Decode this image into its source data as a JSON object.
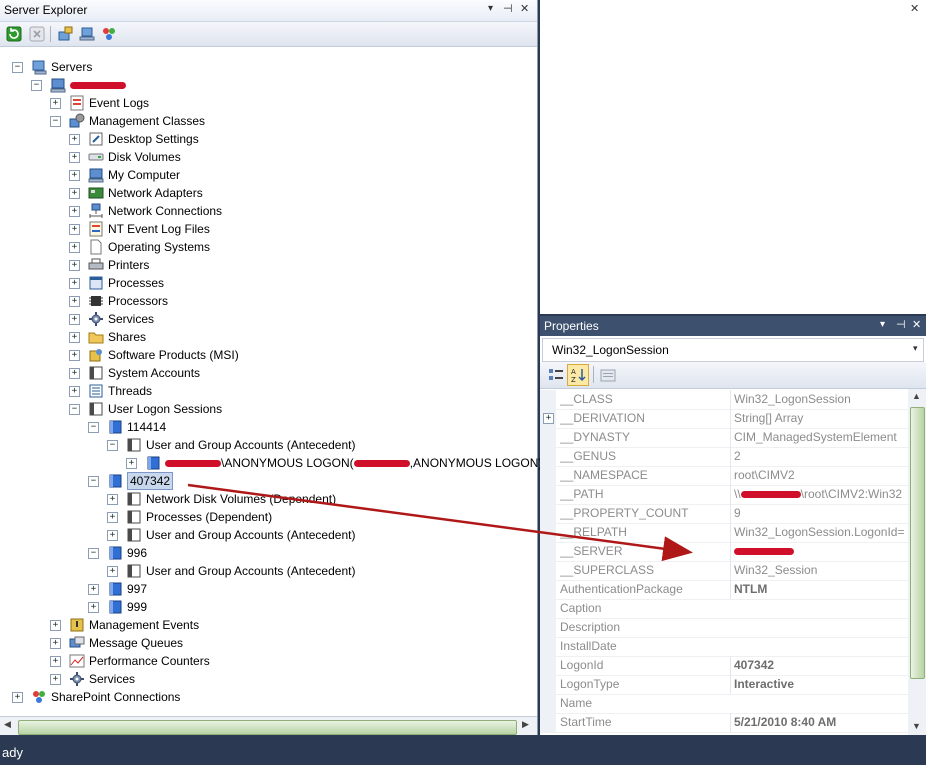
{
  "server_explorer": {
    "title": "Server Explorer",
    "title_buttons": [
      "▾",
      "⊣",
      "✕"
    ],
    "toolbar": [
      "refresh-icon",
      "stop-icon",
      "connect-db-icon",
      "connect-server-icon",
      "sharepoint-icon"
    ]
  },
  "tree": [
    {
      "label": "Servers",
      "icon": "servers-icon",
      "expanded": true
    },
    {
      "label": "",
      "icon": "computer-icon",
      "expanded": true,
      "redacted": true
    },
    {
      "label": "Event Logs",
      "icon": "event-log-icon",
      "expanded": false
    },
    {
      "label": "Management Classes",
      "icon": "management-classes-icon",
      "expanded": true
    },
    {
      "label": "Desktop Settings",
      "icon": "desktop-settings-icon",
      "expanded": false
    },
    {
      "label": "Disk Volumes",
      "icon": "disk-icon",
      "expanded": false
    },
    {
      "label": "My Computer",
      "icon": "computer-icon",
      "expanded": false
    },
    {
      "label": "Network Adapters",
      "icon": "network-adapter-icon",
      "expanded": false
    },
    {
      "label": "Network Connections",
      "icon": "network-connection-icon",
      "expanded": false
    },
    {
      "label": "NT Event Log Files",
      "icon": "event-log-file-icon",
      "expanded": false
    },
    {
      "label": "Operating Systems",
      "icon": "document-icon",
      "expanded": false
    },
    {
      "label": "Printers",
      "icon": "printer-icon",
      "expanded": false
    },
    {
      "label": "Processes",
      "icon": "process-icon",
      "expanded": false
    },
    {
      "label": "Processors",
      "icon": "processor-icon",
      "expanded": false
    },
    {
      "label": "Services",
      "icon": "gear-icon",
      "expanded": false
    },
    {
      "label": "Shares",
      "icon": "folder-icon",
      "expanded": false
    },
    {
      "label": "Software Products (MSI)",
      "icon": "software-icon",
      "expanded": false
    },
    {
      "label": "System Accounts",
      "icon": "class-icon",
      "expanded": false
    },
    {
      "label": "Threads",
      "icon": "thread-icon",
      "expanded": false
    },
    {
      "label": "User Logon Sessions",
      "icon": "class-icon",
      "expanded": true
    },
    {
      "label": "114414",
      "icon": "instance-icon",
      "expanded": true
    },
    {
      "label": "User and Group Accounts (Antecedent)",
      "icon": "class-icon",
      "expanded": true
    },
    {
      "label": "\\ANONYMOUS LOGON(",
      "label2": ",ANONYMOUS LOGON)",
      "icon": "instance-icon",
      "expanded": false,
      "redacted": true
    },
    {
      "label": "407342",
      "icon": "instance-icon",
      "expanded": true,
      "selected": true
    },
    {
      "label": "Network Disk Volumes (Dependent)",
      "icon": "class-icon",
      "expanded": false
    },
    {
      "label": "Processes (Dependent)",
      "icon": "class-icon",
      "expanded": false
    },
    {
      "label": "User and Group Accounts (Antecedent)",
      "icon": "class-icon",
      "expanded": false
    },
    {
      "label": "996",
      "icon": "instance-icon",
      "expanded": true
    },
    {
      "label": "User and Group Accounts (Antecedent)",
      "icon": "class-icon",
      "expanded": false
    },
    {
      "label": "997",
      "icon": "instance-icon",
      "expanded": false
    },
    {
      "label": "999",
      "icon": "instance-icon",
      "expanded": false
    },
    {
      "label": "Management Events",
      "icon": "management-events-icon",
      "expanded": false
    },
    {
      "label": "Message Queues",
      "icon": "message-queue-icon",
      "expanded": false
    },
    {
      "label": "Performance Counters",
      "icon": "performance-icon",
      "expanded": false
    },
    {
      "label": "Services",
      "icon": "gear-icon",
      "expanded": false
    },
    {
      "label": "SharePoint Connections",
      "icon": "sharepoint-icon",
      "expanded": false
    }
  ],
  "properties": {
    "title": "Properties",
    "title_buttons": [
      "▾",
      "⊣",
      "✕"
    ],
    "object": "Win32_LogonSession",
    "rows": [
      {
        "name": "__CLASS",
        "value": "Win32_LogonSession",
        "bold": false
      },
      {
        "name": "__DERIVATION",
        "value": "String[] Array",
        "bold": false,
        "expandable": true
      },
      {
        "name": "__DYNASTY",
        "value": "CIM_ManagedSystemElement",
        "bold": false
      },
      {
        "name": "__GENUS",
        "value": "2",
        "bold": false
      },
      {
        "name": "__NAMESPACE",
        "value": "root\\CIMV2",
        "bold": false
      },
      {
        "name": "__PATH",
        "value": "\\\\",
        "value2": "\\root\\CIMV2:Win32",
        "bold": false,
        "redacted": true
      },
      {
        "name": "__PROPERTY_COUNT",
        "value": "9",
        "bold": false
      },
      {
        "name": "__RELPATH",
        "value": "Win32_LogonSession.LogonId=",
        "bold": false
      },
      {
        "name": "__SERVER",
        "value": "",
        "bold": false,
        "redacted": true
      },
      {
        "name": "__SUPERCLASS",
        "value": "Win32_Session",
        "bold": false
      },
      {
        "name": "AuthenticationPackage",
        "value": "NTLM",
        "bold": true
      },
      {
        "name": "Caption",
        "value": "",
        "bold": false
      },
      {
        "name": "Description",
        "value": "",
        "bold": false
      },
      {
        "name": "InstallDate",
        "value": "",
        "bold": false
      },
      {
        "name": "LogonId",
        "value": "407342",
        "bold": true
      },
      {
        "name": "LogonType",
        "value": "Interactive",
        "bold": true
      },
      {
        "name": "Name",
        "value": "",
        "bold": false
      },
      {
        "name": "StartTime",
        "value": "5/21/2010 8:40 AM",
        "bold": true
      }
    ]
  },
  "status_bar": {
    "text": "ady"
  },
  "colors": {
    "accent": "#3d516f",
    "arrow": "#b01818",
    "redaction": "#d0102a"
  }
}
